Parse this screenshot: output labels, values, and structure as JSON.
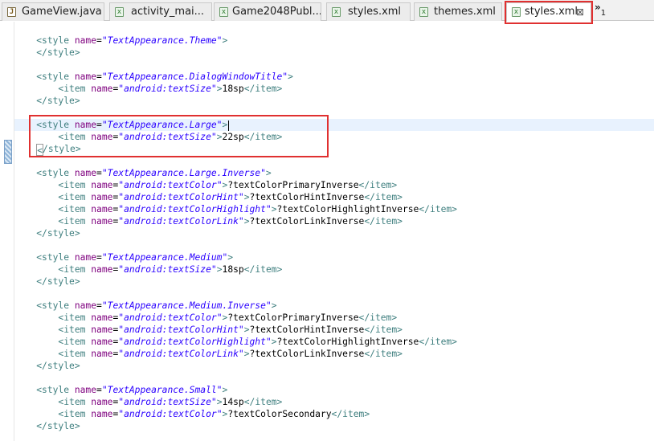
{
  "tabs": [
    {
      "label": "GameView.java",
      "icon": "java-file-icon",
      "active": false
    },
    {
      "label": "activity_mai...",
      "icon": "xml-file-icon",
      "active": false
    },
    {
      "label": "Game2048Publ...",
      "icon": "xml-file-icon",
      "active": false
    },
    {
      "label": "styles.xml",
      "icon": "xml-file-icon",
      "active": false
    },
    {
      "label": "themes.xml",
      "icon": "xml-file-icon",
      "active": false
    },
    {
      "label": "styles.xml",
      "icon": "xml-file-icon",
      "active": true,
      "close": "⊠"
    }
  ],
  "overflow": {
    "glyph": "»",
    "count": "1"
  },
  "code": {
    "open_style": "<style name=",
    "item_open": "<item name=",
    "close_style": "</style>",
    "close_item": "</item>",
    "gt": ">",
    "q": "\"",
    "styles": [
      {
        "name": "TextAppearance.Theme",
        "items": []
      },
      {
        "name": "TextAppearance.DialogWindowTitle",
        "items": [
          {
            "attr": "android:textSize",
            "value": "18sp"
          }
        ]
      },
      {
        "name": "TextAppearance.Large",
        "items": [
          {
            "attr": "android:textSize",
            "value": "22sp"
          }
        ]
      },
      {
        "name": "TextAppearance.Large.Inverse",
        "items": [
          {
            "attr": "android:textColor",
            "value": "?textColorPrimaryInverse"
          },
          {
            "attr": "android:textColorHint",
            "value": "?textColorHintInverse"
          },
          {
            "attr": "android:textColorHighlight",
            "value": "?textColorHighlightInverse"
          },
          {
            "attr": "android:textColorLink",
            "value": "?textColorLinkInverse"
          }
        ]
      },
      {
        "name": "TextAppearance.Medium",
        "items": [
          {
            "attr": "android:textSize",
            "value": "18sp"
          }
        ]
      },
      {
        "name": "TextAppearance.Medium.Inverse",
        "items": [
          {
            "attr": "android:textColor",
            "value": "?textColorPrimaryInverse"
          },
          {
            "attr": "android:textColorHint",
            "value": "?textColorHintInverse"
          },
          {
            "attr": "android:textColorHighlight",
            "value": "?textColorHighlightInverse"
          },
          {
            "attr": "android:textColorLink",
            "value": "?textColorLinkInverse"
          }
        ]
      },
      {
        "name": "TextAppearance.Small",
        "items": [
          {
            "attr": "android:textSize",
            "value": "14sp"
          },
          {
            "attr": "android:textColor",
            "value": "?textColorSecondary"
          }
        ]
      }
    ]
  },
  "colors": {
    "tag": "#3f7f7f",
    "attribute": "#7f007f",
    "value": "#2a00ff",
    "highlight_box": "#e03030",
    "current_line": "#e8f2fe"
  }
}
